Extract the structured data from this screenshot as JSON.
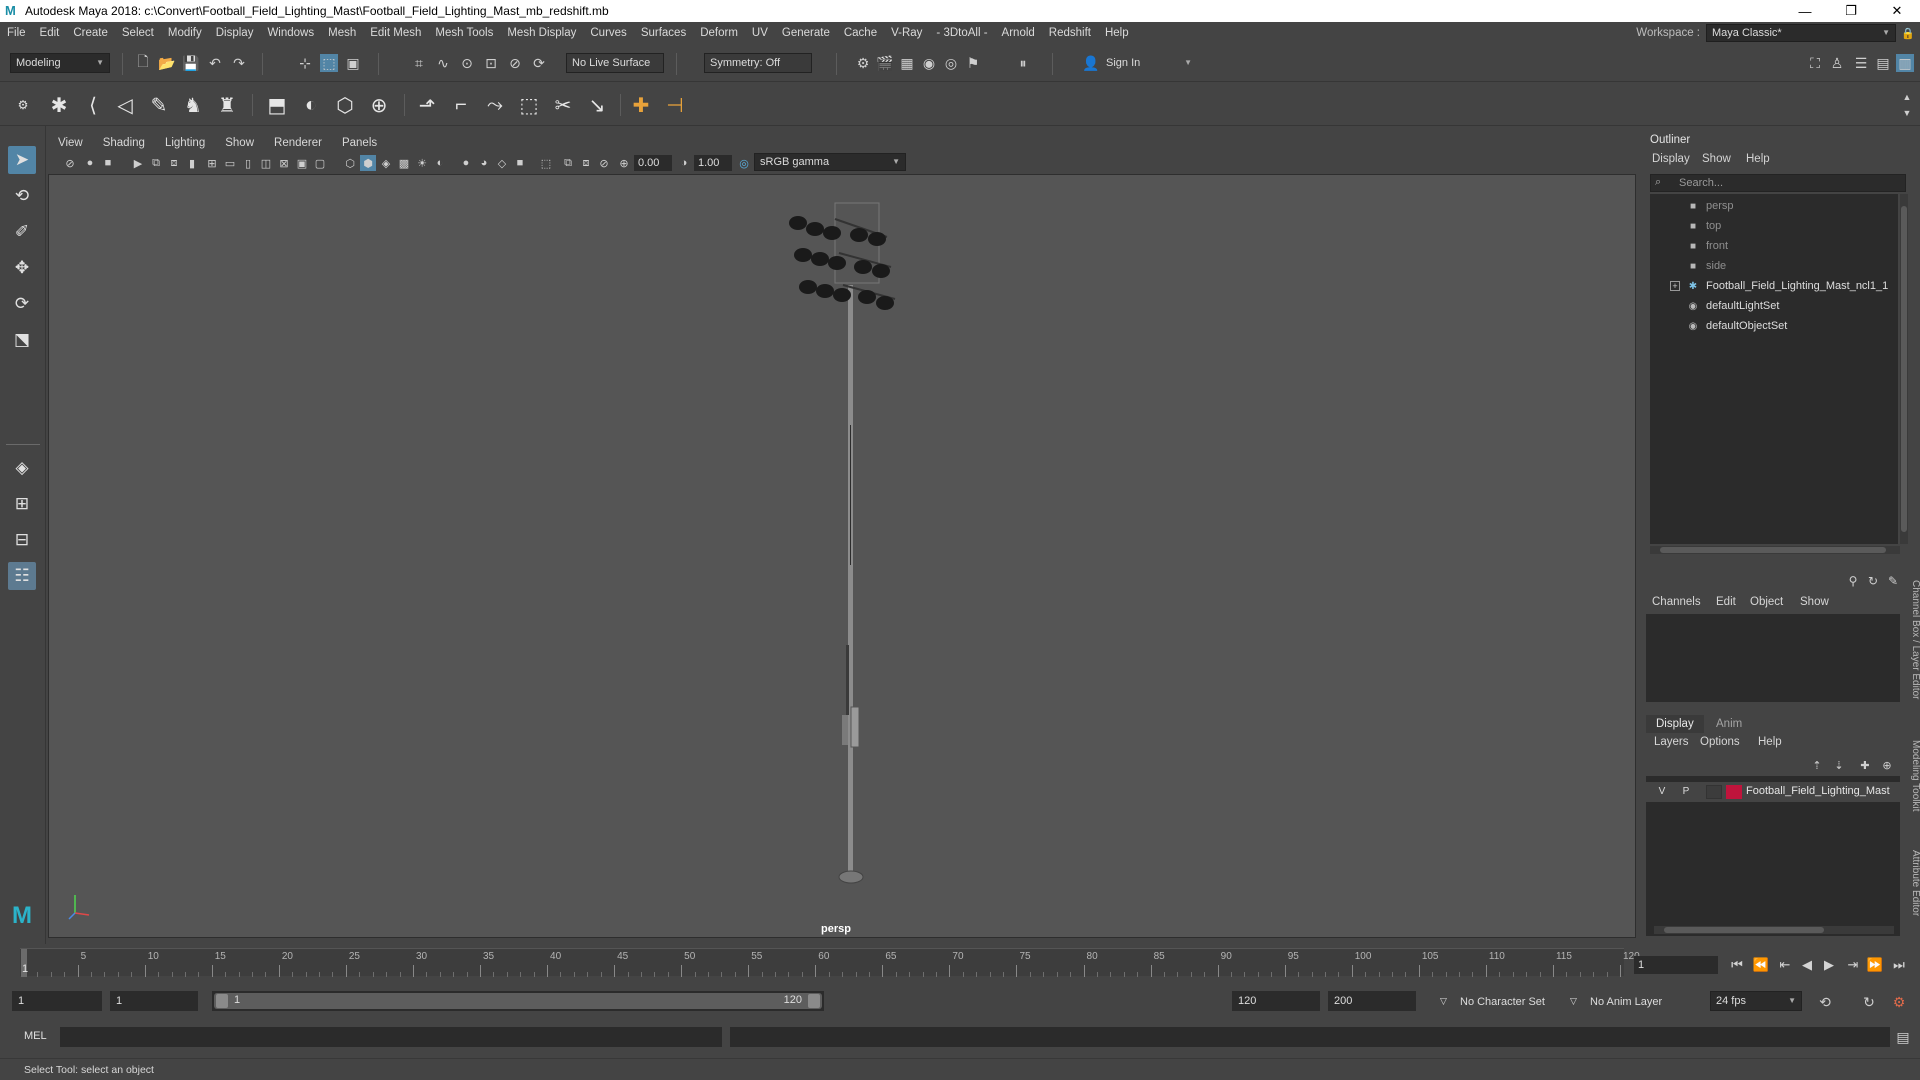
{
  "window": {
    "title": "Autodesk Maya 2018: c:\\Convert\\Football_Field_Lighting_Mast\\Football_Field_Lighting_Mast_mb_redshift.mb",
    "minimize": "—",
    "maximize": "❐",
    "close": "✕"
  },
  "menubar": {
    "items": [
      "File",
      "Edit",
      "Create",
      "Select",
      "Modify",
      "Display",
      "Windows",
      "Mesh",
      "Edit Mesh",
      "Mesh Tools",
      "Mesh Display",
      "Curves",
      "Surfaces",
      "Deform",
      "UV",
      "Generate",
      "Cache",
      "V-Ray",
      "- 3DtoAll -",
      "Arnold",
      "Redshift",
      "Help"
    ],
    "workspace_label": "Workspace :",
    "workspace_value": "Maya Classic*"
  },
  "statusline": {
    "mode": "Modeling",
    "live_surface": "No Live Surface",
    "symmetry": "Symmetry: Off",
    "sign_in": "Sign In"
  },
  "panel": {
    "menu": [
      "View",
      "Shading",
      "Lighting",
      "Show",
      "Renderer",
      "Panels"
    ],
    "exposure": "0.00",
    "gamma": "1.00",
    "color_space": "sRGB gamma",
    "camera": "persp"
  },
  "outliner": {
    "title": "Outliner",
    "menu": [
      "Display",
      "Show",
      "Help"
    ],
    "search_placeholder": "Search...",
    "items": [
      {
        "label": "persp",
        "icon": "camera-icon",
        "dim": true
      },
      {
        "label": "top",
        "icon": "camera-icon",
        "dim": true
      },
      {
        "label": "front",
        "icon": "camera-icon",
        "dim": true
      },
      {
        "label": "side",
        "icon": "camera-icon",
        "dim": true
      },
      {
        "label": "Football_Field_Lighting_Mast_ncl1_1",
        "icon": "transform-icon",
        "dim": false,
        "expandable": true
      },
      {
        "label": "defaultLightSet",
        "icon": "set-icon",
        "dim": false
      },
      {
        "label": "defaultObjectSet",
        "icon": "set-icon",
        "dim": false
      }
    ]
  },
  "channelbox": {
    "menu": [
      "Channels",
      "Edit",
      "Object",
      "Show"
    ]
  },
  "layers": {
    "tabs": [
      "Display",
      "Anim"
    ],
    "menu": [
      "Layers",
      "Options",
      "Help"
    ],
    "layer": {
      "v": "V",
      "p": "P",
      "name": "Football_Field_Lighting_Mast",
      "color": "#c0143c"
    }
  },
  "sidetabs": [
    "Channel Box / Layer Editor",
    "Modeling Toolkit",
    "Attribute Editor"
  ],
  "timeline": {
    "ticks": [
      "5",
      "10",
      "15",
      "20",
      "25",
      "30",
      "35",
      "40",
      "45",
      "50",
      "55",
      "60",
      "65",
      "70",
      "75",
      "80",
      "85",
      "90",
      "95",
      "100",
      "105",
      "110",
      "115",
      "120"
    ],
    "current_frame": "1",
    "frame_field": "1"
  },
  "range": {
    "start": "1",
    "playback_start": "1",
    "slider_start": "1",
    "slider_end": "120",
    "playback_end": "120",
    "end": "200",
    "character_set": "No Character Set",
    "anim_layer": "No Anim Layer",
    "fps": "24 fps"
  },
  "cmdline": {
    "label": "MEL"
  },
  "helpline": {
    "text": "Select Tool: select an object"
  }
}
